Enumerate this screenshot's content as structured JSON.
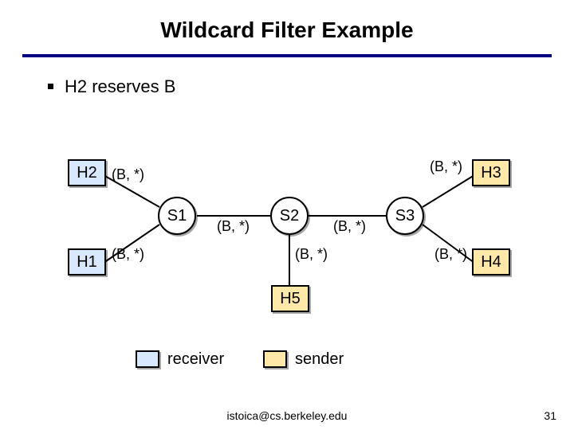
{
  "title": "Wildcard Filter Example",
  "bullet": "H2 reserves B",
  "edge_label": "(B, *)",
  "nodes": {
    "h1": "H1",
    "h2": "H2",
    "h3": "H3",
    "h4": "H4",
    "h5": "H5",
    "s1": "S1",
    "s2": "S2",
    "s3": "S3"
  },
  "legend": {
    "receiver": "receiver",
    "sender": "sender"
  },
  "footer": {
    "email": "istoica@cs.berkeley.edu",
    "page": "31"
  }
}
